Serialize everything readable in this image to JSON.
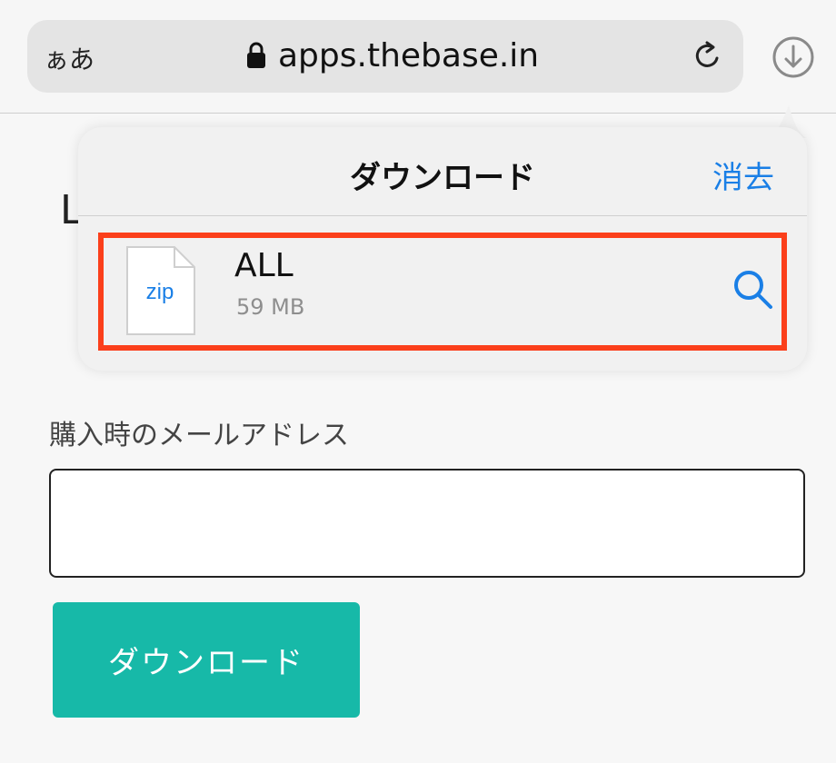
{
  "browser": {
    "text_size_label": "ぁあ",
    "url": "apps.thebase.in"
  },
  "page": {
    "heading_partial": "L",
    "email_label": "購入時のメールアドレス",
    "email_value": "",
    "download_button_label": "ダウンロード",
    "accent_color": "#17b9a8"
  },
  "downloads_popover": {
    "title": "ダウンロード",
    "clear_label": "消去",
    "items": [
      {
        "file_type": "zip",
        "name": "ALL",
        "size": "59 MB"
      }
    ],
    "highlight_color": "#fb3f1b",
    "link_color": "#1a7fe6"
  }
}
